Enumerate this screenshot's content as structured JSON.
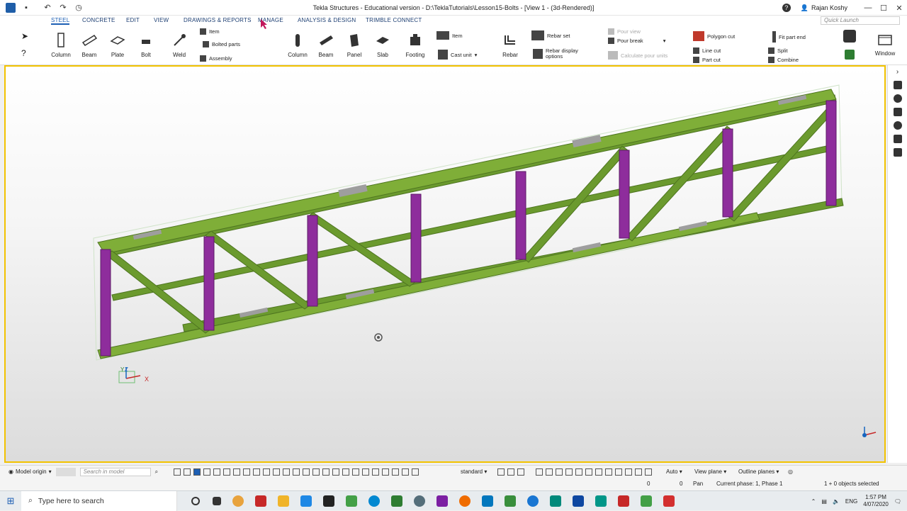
{
  "titlebar": {
    "title": "Tekla Structures - Educational version - D:\\TeklaTutorials\\Lesson15-Bolts - [View 1 - (3d-Rendered)]",
    "user": "Rajan Koshy",
    "help": "?",
    "minimize": "—",
    "maximize": "☐",
    "close": "✕"
  },
  "tabs": [
    "STEEL",
    "CONCRETE",
    "EDIT",
    "VIEW",
    "DRAWINGS & REPORTS",
    "MANAGE",
    "ANALYSIS & DESIGN",
    "TRIMBLE CONNECT"
  ],
  "quick_launch_placeholder": "Quick Launch",
  "ribbon": {
    "steel": {
      "column": "Column",
      "beam": "Beam",
      "plate": "Plate",
      "bolt": "Bolt",
      "weld": "Weld",
      "item": "Item",
      "bolted_parts": "Bolted parts",
      "assembly": "Assembly"
    },
    "concrete": {
      "column": "Column",
      "beam": "Beam",
      "panel": "Panel",
      "slab": "Slab",
      "footing": "Footing",
      "item": "Item",
      "cast_unit": "Cast unit"
    },
    "rebar": {
      "rebar": "Rebar",
      "rebar_set": "Rebar set",
      "rebar_display_line1": "Rebar display",
      "rebar_display_line2": "options"
    },
    "pour": {
      "pour_view": "Pour view",
      "pour_break": "Pour break",
      "calculate_pour_units": "Calculate pour units"
    },
    "edit": {
      "polygon_cut": "Polygon cut",
      "line_cut": "Line cut",
      "part_cut": "Part cut",
      "fit_part_end": "Fit part end",
      "split": "Split",
      "combine": "Combine"
    },
    "window": "Window"
  },
  "statusbar": {
    "model_origin": "Model origin",
    "search_placeholder": "Search in model",
    "view_filter": "standard",
    "auto": "Auto",
    "view_plane": "View plane",
    "outline_planes": "Outline planes",
    "coord_x": "0",
    "coord_y": "0",
    "mode": "Pan",
    "current_phase": "Current phase: 1, Phase 1",
    "selected": "1 + 0 objects selected"
  },
  "axes_labels": {
    "z": "Z",
    "y": "Y",
    "x": "X"
  },
  "taskbar": {
    "search_placeholder": "Type here to search",
    "language": "ENG",
    "time": "1:57 PM",
    "date": "4/07/2020"
  },
  "colors": {
    "member_green": "#6b9a2e",
    "column_purple": "#8e2d9c",
    "viewport_border": "#f2c200",
    "accent_blue": "#1d5fb4"
  }
}
